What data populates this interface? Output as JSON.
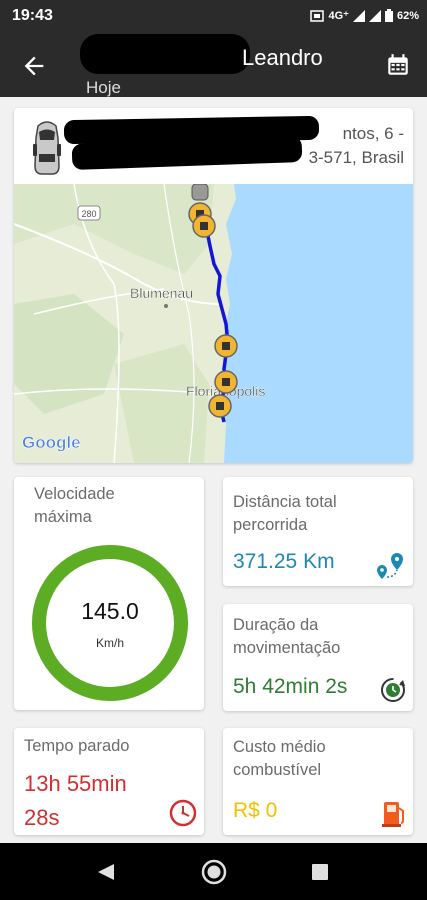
{
  "status_bar": {
    "time": "19:43",
    "network": "4G⁺",
    "battery": "62%"
  },
  "app_bar": {
    "title": "Leandro",
    "subtitle": "Hoje"
  },
  "address": {
    "line1": "ntos, 6 -",
    "line2": "3-571, Brasil"
  },
  "map": {
    "city1": "Blumenau",
    "city2": "Florianópolis",
    "road_shield": "280",
    "attribution": "Google"
  },
  "metrics": {
    "max_speed": {
      "label": "Velocidade máxima",
      "value": "145.0",
      "unit": "Km/h",
      "gauge_fraction": 1.0
    },
    "distance": {
      "label": "Distância total percorrida",
      "value": "371.25 Km"
    },
    "duration": {
      "label": "Duração da movimentação",
      "value": "5h 42min 2s"
    },
    "stopped": {
      "label": "Tempo parado",
      "value_line1": "13h 55min",
      "value_line2": "28s"
    },
    "fuel": {
      "label": "Custo médio combustível",
      "value": "R$ 0"
    }
  },
  "colors": {
    "accent_blue": "#1e88b4",
    "green": "#2e7d32",
    "red": "#d32f2f",
    "gold": "#f2c200",
    "gauge_green": "#5cad23"
  }
}
